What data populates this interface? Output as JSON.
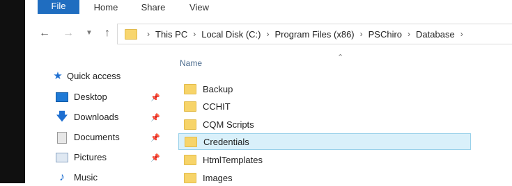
{
  "ribbon": {
    "tabs": [
      {
        "label": "File"
      },
      {
        "label": "Home"
      },
      {
        "label": "Share"
      },
      {
        "label": "View"
      }
    ]
  },
  "address": {
    "crumbs": [
      "This PC",
      "Local Disk (C:)",
      "Program Files (x86)",
      "PSChiro",
      "Database"
    ]
  },
  "column": {
    "name_header": "Name"
  },
  "nav": {
    "quick_access": "Quick access",
    "items": [
      {
        "label": "Desktop",
        "icon": "desktop-icon",
        "pinned": true
      },
      {
        "label": "Downloads",
        "icon": "download-icon",
        "pinned": true
      },
      {
        "label": "Documents",
        "icon": "documents-icon",
        "pinned": true
      },
      {
        "label": "Pictures",
        "icon": "pictures-icon",
        "pinned": true
      },
      {
        "label": "Music",
        "icon": "music-icon",
        "pinned": false
      }
    ]
  },
  "files": [
    {
      "name": "Backup",
      "selected": false
    },
    {
      "name": "CCHIT",
      "selected": false
    },
    {
      "name": "CQM Scripts",
      "selected": false
    },
    {
      "name": "Credentials",
      "selected": true
    },
    {
      "name": "HtmlTemplates",
      "selected": false
    },
    {
      "name": "Images",
      "selected": false
    }
  ],
  "colors": {
    "accent": "#1f6dc0",
    "folder": "#f7d469",
    "selection": "#d9f0fa"
  }
}
